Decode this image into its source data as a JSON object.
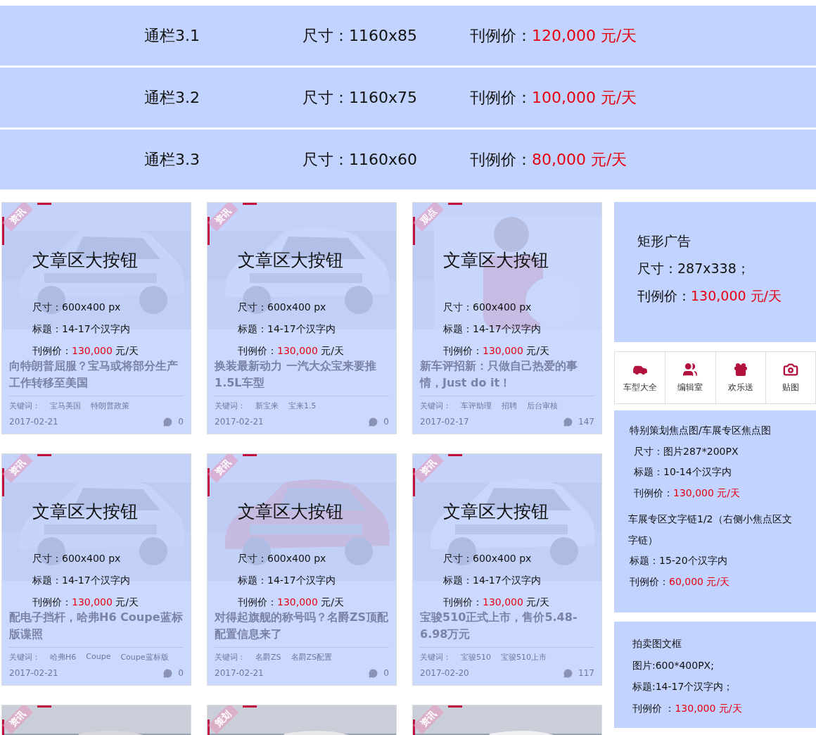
{
  "banners": [
    {
      "name": "通栏3.1",
      "size": "尺寸：1160x85",
      "price_label": "刊例价：",
      "price": "120,000 元/天"
    },
    {
      "name": "通栏3.2",
      "size": "尺寸：1160x75",
      "price_label": "刊例价：",
      "price": "100,000 元/天"
    },
    {
      "name": "通栏3.3",
      "size": "尺寸：1160x60",
      "price_label": "刊例价：",
      "price": "80,000 元/天"
    }
  ],
  "cards": [
    {
      "tag": "资讯",
      "overlay": {
        "title": "文章区大按钮",
        "size": "尺寸：600x400 px",
        "title_rule": "标题：14-17个汉字内",
        "price_label": "刊例价：",
        "price": "130,000",
        "unit": "元/天"
      },
      "article": {
        "title": "向特朗普屈服？宝马或将部分生产工作转移至美国",
        "keyword_label": "关键词：",
        "keywords": [
          "宝马美国",
          "特朗普政策"
        ],
        "date": "2017-02-21",
        "comments": "0"
      }
    },
    {
      "tag": "资讯",
      "overlay": {
        "title": "文章区大按钮",
        "size": "尺寸：600x400 px",
        "title_rule": "标题：14-17个汉字内",
        "price_label": "刊例价：",
        "price": "130,000",
        "unit": "元/天"
      },
      "article": {
        "title": "换装最新动力 一汽大众宝来要推1.5L车型",
        "keyword_label": "关键词：",
        "keywords": [
          "新宝来",
          "宝来1.5"
        ],
        "date": "2017-02-21",
        "comments": "0"
      }
    },
    {
      "tag": "观点",
      "overlay": {
        "title": "文章区大按钮",
        "size": "尺寸：600x400 px",
        "title_rule": "标题：14-17个汉字内",
        "price_label": "刊例价：",
        "price": "130,000",
        "unit": "元/天"
      },
      "article": {
        "title": "新车评招新：只做自己热爱的事情，Just do it！",
        "keyword_label": "关键词：",
        "keywords": [
          "车评助理",
          "招聘",
          "后台审核"
        ],
        "date": "2017-02-17",
        "comments": "147"
      }
    },
    {
      "tag": "资讯",
      "overlay": {
        "title": "文章区大按钮",
        "size": "尺寸：600x400 px",
        "title_rule": "标题：14-17个汉字内",
        "price_label": "刊例价：",
        "price": "130,000",
        "unit": "元/天"
      },
      "article": {
        "title": "配电子挡杆，哈弗H6 Coupe蓝标版谍照",
        "keyword_label": "关键词：",
        "keywords": [
          "哈弗H6",
          "Coupe",
          "Coupe蓝标版"
        ],
        "date": "2017-02-21",
        "comments": "0"
      }
    },
    {
      "tag": "资讯",
      "overlay": {
        "title": "文章区大按钮",
        "size": "尺寸：600x400 px",
        "title_rule": "标题：14-17个汉字内",
        "price_label": "刊例价：",
        "price": "130,000",
        "unit": "元/天"
      },
      "article": {
        "title": "对得起旗舰的称号吗？名爵ZS顶配配置信息来了",
        "keyword_label": "关键词：",
        "keywords": [
          "名爵ZS",
          "名爵ZS配置"
        ],
        "date": "2017-02-21",
        "comments": "0"
      }
    },
    {
      "tag": "资讯",
      "overlay": {
        "title": "文章区大按钮",
        "size": "尺寸：600x400 px",
        "title_rule": "标题：14-17个汉字内",
        "price_label": "刊例价：",
        "price": "130,000",
        "unit": "元/天"
      },
      "article": {
        "title": "宝骏510正式上市，售价5.48-6.98万元",
        "keyword_label": "关键词：",
        "keywords": [
          "宝骏510",
          "宝骏510上市"
        ],
        "date": "2017-02-20",
        "comments": "117"
      }
    },
    {
      "tag": "资讯"
    },
    {
      "tag": "策划"
    },
    {
      "tag": "资讯"
    }
  ],
  "rect_ad": {
    "title": "矩形广告",
    "size": "尺寸：287x338；",
    "price_label": "刊例价：",
    "price": "130,000 元/天"
  },
  "quick_links": [
    {
      "kind": "car",
      "label": "车型大全"
    },
    {
      "kind": "people",
      "label": "编辑室"
    },
    {
      "kind": "gift",
      "label": "欢乐送"
    },
    {
      "kind": "camera",
      "label": "贴图"
    }
  ],
  "focus_panel": {
    "title": "特别策划焦点图/车展专区焦点图",
    "size": "尺寸：图片287*200PX",
    "title_rule": "标题：10-14个汉字内",
    "price_label": "刊例价：",
    "price": "130,000 元/天",
    "link_title": "车展专区文字链1/2（右侧小焦点区文字链）",
    "link_rule": "标题：15-20个汉字内",
    "link_price_label": "刊例价：",
    "link_price": "60,000 元/天"
  },
  "auction_panel": {
    "title": "拍卖图文框",
    "size": "图片:600*400PX;",
    "title_rule": "标题:14-17个汉字内；",
    "price_label": "刊例价 ：",
    "price": "130,000 元/天"
  }
}
